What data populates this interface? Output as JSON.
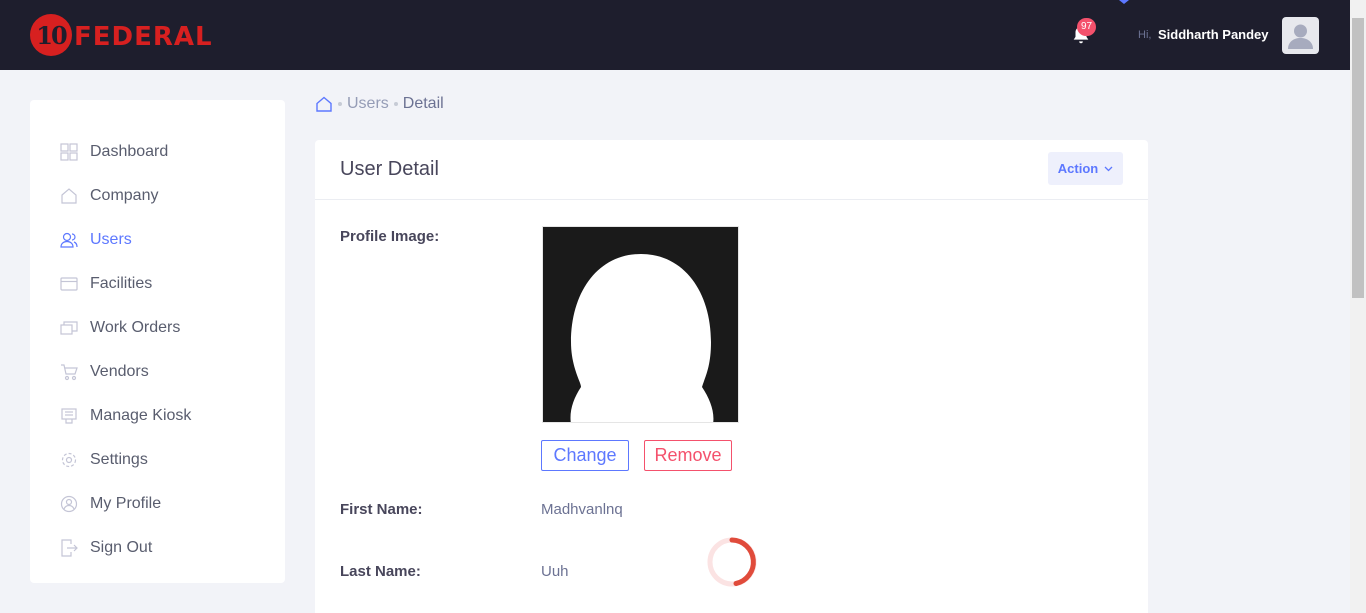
{
  "header": {
    "logo_number": "10",
    "logo_text": "FEDERAL",
    "notification_count": "97",
    "greeting": "Hi,",
    "user_name": "Siddharth Pandey"
  },
  "sidebar": {
    "items": [
      {
        "label": "Dashboard",
        "icon": "dashboard-icon"
      },
      {
        "label": "Company",
        "icon": "home-icon"
      },
      {
        "label": "Users",
        "icon": "users-icon",
        "active": true
      },
      {
        "label": "Facilities",
        "icon": "facilities-icon"
      },
      {
        "label": "Work Orders",
        "icon": "work-orders-icon"
      },
      {
        "label": "Vendors",
        "icon": "cart-icon"
      },
      {
        "label": "Manage Kiosk",
        "icon": "kiosk-icon"
      },
      {
        "label": "Settings",
        "icon": "gear-icon"
      },
      {
        "label": "My Profile",
        "icon": "profile-icon"
      },
      {
        "label": "Sign Out",
        "icon": "sign-out-icon"
      }
    ]
  },
  "breadcrumb": {
    "link": "Users",
    "current": "Detail"
  },
  "card": {
    "title": "User Detail",
    "action_label": "Action",
    "profile_image_label": "Profile Image:",
    "change_label": "Change",
    "remove_label": "Remove",
    "first_name_label": "First Name:",
    "first_name_value": "Madhvanlnq",
    "last_name_label": "Last Name:",
    "last_name_value": "Uuh"
  },
  "colors": {
    "header_bg": "#1e1e2d",
    "accent": "#5d78ff",
    "danger": "#f4516c",
    "brand_red": "#d72020"
  }
}
